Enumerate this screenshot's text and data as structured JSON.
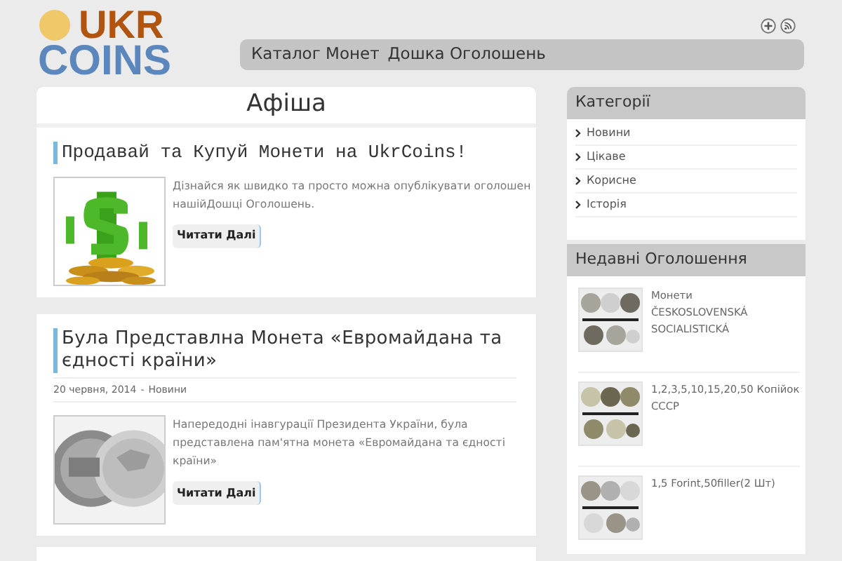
{
  "logo": {
    "top": "UKR",
    "bottom": "COINS"
  },
  "nav": {
    "items": [
      "Каталог Монет",
      "Дошка Оголошень"
    ]
  },
  "main": {
    "title": "Афіша",
    "articles": [
      {
        "kind": "mono",
        "title": "Продавай та Купуй Монети на UkrCoins!",
        "excerpt_lines": [
          "Дізнайся як швидко та просто можна опублікувати оголошен",
          "нашійДошці Оголошень."
        ],
        "button": "Читати Далі"
      },
      {
        "kind": "sans",
        "title": "Була Представлна Монета «Евромайдана та єдності країни»",
        "date": "20 червня, 2014",
        "separator": "-",
        "category": "Новини",
        "excerpt_lines": [
          "Напередодні інавгурації Президента України, була",
          "представлена пам'ятна монета «Евромайдана та єдності",
          "країни»"
        ],
        "button": "Читати Далі"
      }
    ]
  },
  "sidebar": {
    "categories": {
      "title": "Категорії",
      "items": [
        "Новини",
        "Цікаве",
        "Корисне",
        "Історія"
      ]
    },
    "ads": {
      "title": "Недавні Оголошення",
      "items": [
        {
          "title_lines": [
            "Монети",
            "ČESKOSLOVENSKÁ",
            "SOCIALISTICKÁ"
          ]
        },
        {
          "title_lines": [
            "1,2,3,5,10,15,20,50 Копійок",
            "СССР"
          ]
        },
        {
          "title_lines": [
            "1,5 Forint,50filler(2 Шт)"
          ]
        }
      ]
    }
  }
}
